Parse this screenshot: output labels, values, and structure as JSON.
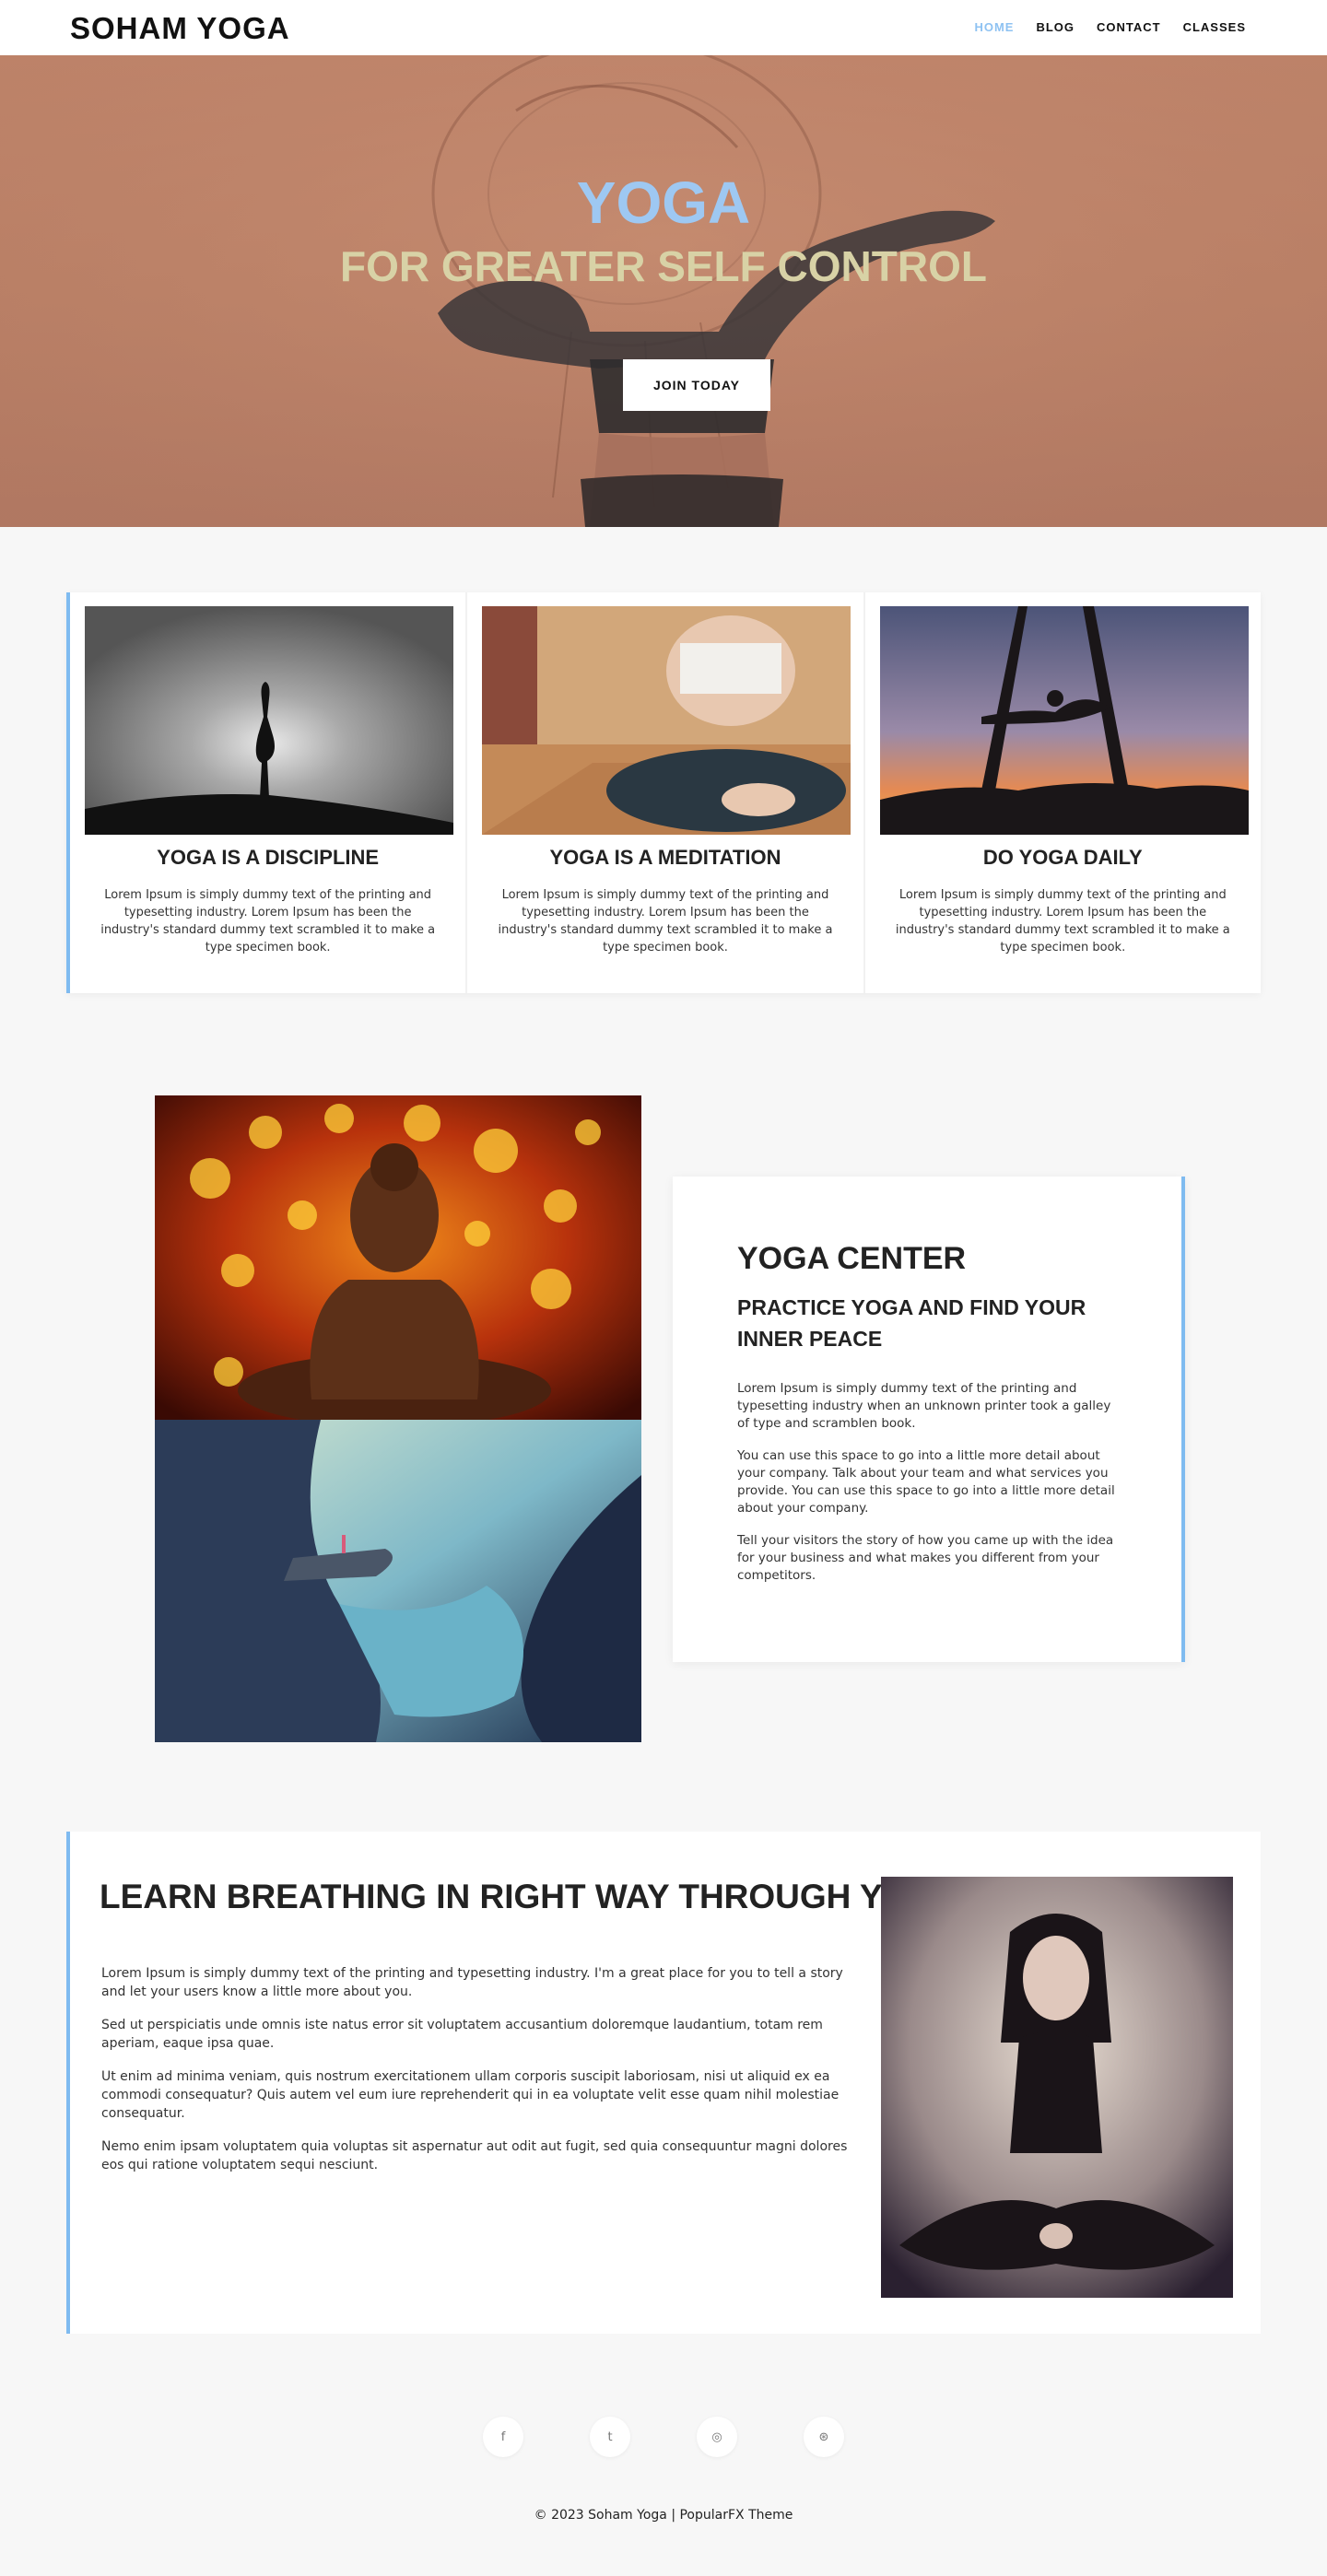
{
  "header": {
    "logo": "SOHAM YOGA",
    "nav": [
      "HOME",
      "BLOG",
      "CONTACT",
      "CLASSES"
    ]
  },
  "hero": {
    "title": "YOGA",
    "subtitle": "FOR GREATER SELF CONTROL",
    "button": "JOIN TODAY"
  },
  "features": [
    {
      "title": "YOGA IS A DISCIPLINE",
      "text": "Lorem Ipsum is simply dummy text of the printing and typesetting industry. Lorem Ipsum has been the industry's standard dummy text scrambled it to make a type specimen book."
    },
    {
      "title": "YOGA IS A MEDITATION",
      "text": "Lorem Ipsum is simply dummy text of the printing and typesetting industry. Lorem Ipsum has been the industry's standard dummy text scrambled it to make a type specimen book."
    },
    {
      "title": "DO YOGA DAILY",
      "text": "Lorem Ipsum is simply dummy text of the printing and typesetting industry. Lorem Ipsum has been the industry's standard dummy text scrambled it to make a type specimen book."
    }
  ],
  "about": {
    "title": "YOGA CENTER",
    "subtitle": "PRACTICE YOGA AND FIND YOUR INNER PEACE",
    "paragraphs": [
      "Lorem Ipsum is simply dummy text of the printing and typesetting industry when an unknown printer took a galley of type and scramblen book.",
      "You can use this space to go into a little more detail about your company. Talk about your team and what services you provide. You can use this space to go into a little more detail about your company.",
      "Tell your visitors the story of how you came up with the idea for your business and what makes you different from your competitors."
    ]
  },
  "breathing": {
    "title": "LEARN BREATHING IN RIGHT WAY THROUGH YOGA",
    "paragraphs": [
      "Lorem Ipsum is simply dummy text of the printing and typesetting industry. I'm a great place for you to tell a story and let your users know a little more about you.",
      "Sed ut perspiciatis unde omnis iste natus error sit voluptatem accusantium doloremque laudantium, totam rem aperiam, eaque ipsa quae.",
      "Ut enim ad minima veniam, quis nostrum exercitationem ullam corporis suscipit laboriosam, nisi ut aliquid ex ea commodi consequatur? Quis autem vel eum iure reprehenderit qui in ea voluptate velit esse quam nihil molestiae consequatur.",
      "Nemo enim ipsam voluptatem quia voluptas sit aspernatur aut odit aut fugit, sed quia consequuntur magni dolores eos qui ratione voluptatem sequi nesciunt."
    ]
  },
  "footer": {
    "social": [
      {
        "icon": "facebook-icon",
        "glyph": "f"
      },
      {
        "icon": "twitter-icon",
        "glyph": "t"
      },
      {
        "icon": "instagram-icon",
        "glyph": "◎"
      },
      {
        "icon": "dribbble-icon",
        "glyph": "⊛"
      }
    ],
    "copyright": "© 2023 Soham Yoga | PopularFX Theme"
  },
  "colors": {
    "accent": "#7fbbf0",
    "nav_active": "#8ec2f2",
    "hero_title": "#9ec8f2",
    "hero_subtitle": "#d8d2a6"
  }
}
